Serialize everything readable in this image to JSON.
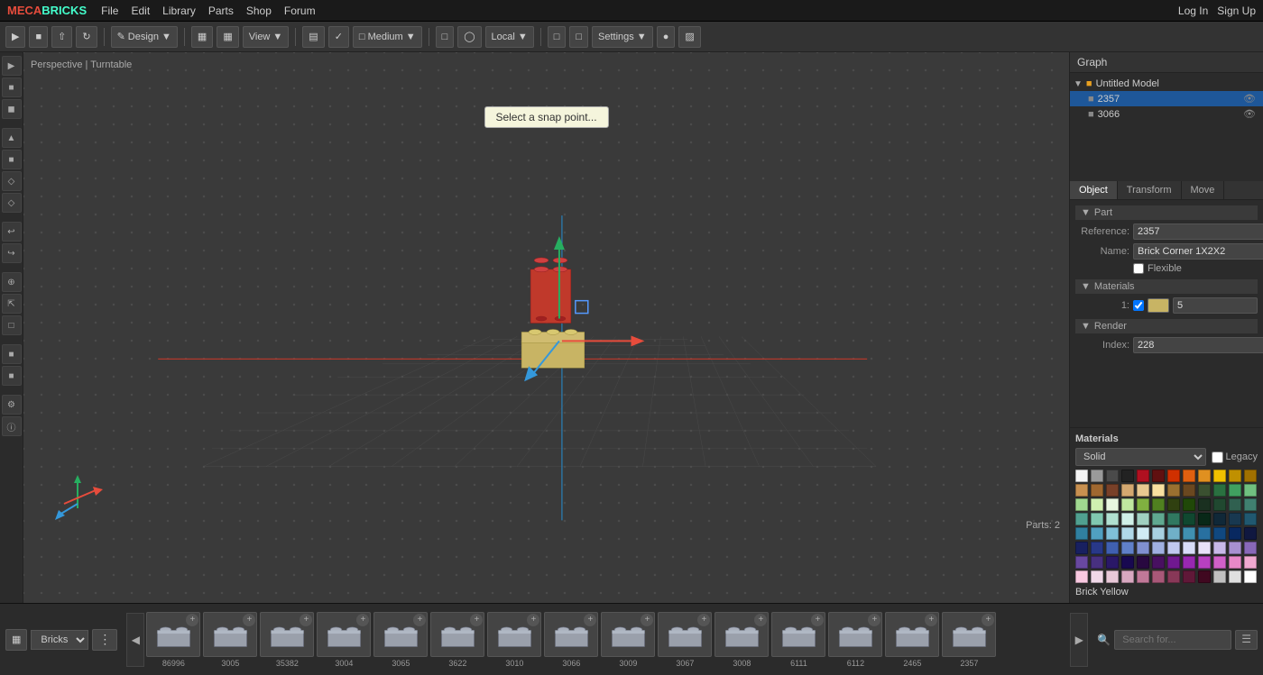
{
  "app": {
    "title": "MECABRICKS",
    "logo_m": "MECA",
    "logo_b": "BRICKS"
  },
  "nav": {
    "items": [
      "File",
      "Edit",
      "Library",
      "Parts",
      "Shop",
      "Forum"
    ],
    "auth": [
      "Log In",
      "Sign Up"
    ]
  },
  "toolbar": {
    "mode": "Design",
    "view": "View",
    "grid": "Medium",
    "coord": "Local",
    "settings": "Settings",
    "icons": [
      "cursor",
      "select",
      "move",
      "rotate",
      "scale"
    ]
  },
  "viewport": {
    "label": "Perspective | Turntable",
    "snap_tooltip": "Select a snap point...",
    "parts_count": "Parts: 2"
  },
  "graph": {
    "title": "Graph",
    "tree": [
      {
        "id": "root",
        "label": "Untitled Model",
        "type": "model",
        "indent": 0
      },
      {
        "id": "2357",
        "label": "2357",
        "type": "part",
        "indent": 1,
        "selected": true
      },
      {
        "id": "3066",
        "label": "3066",
        "type": "part",
        "indent": 1,
        "selected": false
      }
    ]
  },
  "properties": {
    "tabs": [
      "Object",
      "Transform",
      "Move"
    ],
    "active_tab": "Object",
    "part": {
      "reference": "2357",
      "name": "Brick Corner 1X2X2",
      "flexible": false
    },
    "materials": {
      "index_label": "Index:",
      "index_value": "228",
      "number": "1",
      "color_hex": "#c8b464",
      "color_value": "5"
    },
    "render": {
      "label": "Render"
    }
  },
  "materials_panel": {
    "title": "Materials",
    "mode": "Solid",
    "legacy_label": "Legacy",
    "color_name": "Brick Yellow",
    "color_id": "5",
    "colors": [
      "#f5f5f5",
      "#9a9a9a",
      "#4a4a4a",
      "#222222",
      "#b01020",
      "#601010",
      "#d03000",
      "#e06010",
      "#e09020",
      "#f0c000",
      "#c09000",
      "#a07000",
      "#c89050",
      "#a06830",
      "#784028",
      "#d4a870",
      "#e8c890",
      "#f8e0a0",
      "#9a7030",
      "#6a4820",
      "#3a5030",
      "#2a7040",
      "#40a060",
      "#70c080",
      "#a0d890",
      "#d0f0b0",
      "#e8f8e0",
      "#c0e8a0",
      "#80b040",
      "#508020",
      "#304010",
      "#204808",
      "#1a3020",
      "#204830",
      "#306050",
      "#408070",
      "#50a090",
      "#80c8b0",
      "#b0e0d0",
      "#d0f0e8",
      "#a0d0c0",
      "#60a890",
      "#307860",
      "#104830",
      "#082818",
      "#102838",
      "#183850",
      "#205870",
      "#3080a0",
      "#50a0c0",
      "#80c0d8",
      "#b0d8e8",
      "#d0ecf5",
      "#a8d0e0",
      "#70b0c8",
      "#4090b0",
      "#2870a0",
      "#104880",
      "#082860",
      "#101840",
      "#182060",
      "#283888",
      "#4060b0",
      "#6080c8",
      "#8090d0",
      "#a0b0e0",
      "#c0c8f0",
      "#d8dcf8",
      "#e8e0f8",
      "#c8b8e8",
      "#a890d0",
      "#8868b8",
      "#6848a0",
      "#483080",
      "#2a1868",
      "#180850",
      "#280840",
      "#481060",
      "#701890",
      "#9828b0",
      "#b840c0",
      "#d060c8",
      "#e888c8",
      "#f0a8d0",
      "#f8c8e0",
      "#f0d8e8",
      "#e8c8d8",
      "#d8a8c0",
      "#c07898",
      "#a85878",
      "#883858",
      "#601838",
      "#400820",
      "#c0c0c0",
      "#e0e0e0",
      "#ffffff"
    ]
  },
  "bottom_bar": {
    "category": "Bricks",
    "search_placeholder": "Search for...",
    "parts": [
      {
        "id": "86996"
      },
      {
        "id": "3005"
      },
      {
        "id": "35382"
      },
      {
        "id": "3004"
      },
      {
        "id": "3065"
      },
      {
        "id": "3622"
      },
      {
        "id": "3010"
      },
      {
        "id": "3066"
      },
      {
        "id": "3009"
      },
      {
        "id": "3067"
      },
      {
        "id": "3008"
      },
      {
        "id": "6111"
      },
      {
        "id": "6112"
      },
      {
        "id": "2465"
      },
      {
        "id": "2357"
      }
    ]
  }
}
